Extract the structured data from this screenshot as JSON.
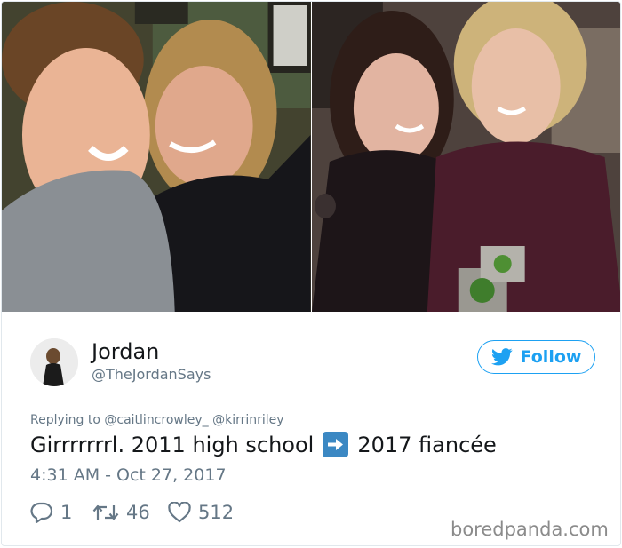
{
  "tweet": {
    "display_name": "Jordan",
    "handle": "@TheJordanSays",
    "follow_label": "Follow",
    "reply_to": "Replying to @caitlincrowley_ @kirrinriley",
    "text_before": "Girrrrrrrl. 2011 high school",
    "text_after": "2017 fiancée",
    "emoji": "right-arrow-emoji",
    "timestamp": "4:31 AM - Oct 27, 2017",
    "replies": "1",
    "retweets": "46",
    "likes": "512"
  },
  "watermark": "boredpanda.com",
  "colors": {
    "twitter_blue": "#1da1f2",
    "secondary_text": "#657786",
    "primary_text": "#14171a",
    "emoji_blue": "#3b88c3"
  },
  "icons": {
    "follow": "twitter-bird-icon",
    "reply": "reply-bubble-icon",
    "retweet": "retweet-icon",
    "like": "heart-icon"
  }
}
